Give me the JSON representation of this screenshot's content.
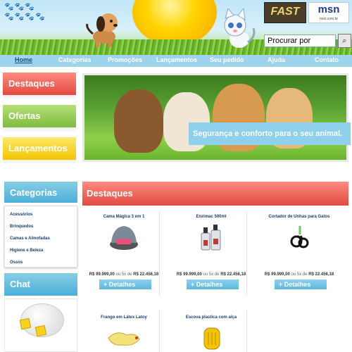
{
  "header": {
    "fast_logo": "FAST",
    "msn_logo": "msn",
    "msn_sub": "msn.com.br",
    "search_placeholder": "Procurar por",
    "search_icon": "magnifier-icon"
  },
  "nav": {
    "items": [
      "Home",
      "Categorias",
      "Promoções",
      "Lançamentos",
      "Seu pedido",
      "Ajuda",
      "Contato"
    ],
    "active": "Home"
  },
  "sidebar": {
    "tabs": [
      "Destaques",
      "Ofertas",
      "Lançamentos"
    ],
    "categories_title": "Categorias",
    "categories": [
      "Acessórios",
      "Brinquedos",
      "Camas e Almofadas",
      "Higiene e Beleza",
      "Ossos"
    ],
    "chat_title": "Chat"
  },
  "banner": {
    "tagline": "Segurança e conforto para o seu animal."
  },
  "products": {
    "title": "Destaques",
    "button_label": "+ Detalhes",
    "items": [
      {
        "name": "Cama Mágica 3 em 1",
        "price": "R$ 99.999,00",
        "ou": "ou 5x de",
        "parcel": "R$ 22.456,18"
      },
      {
        "name": "Enzimac 500ml",
        "price": "R$ 99.999,00",
        "ou": "ou 5x de",
        "parcel": "R$ 22.456,18"
      },
      {
        "name": "Cortador de Unhas para Gatos",
        "price": "R$ 99.999,00",
        "ou": "ou 5x de",
        "parcel": "R$ 22.456,18"
      },
      {
        "name": "Frango em Látex Latoy"
      },
      {
        "name": "Escova plastica com alça"
      }
    ]
  },
  "colors": {
    "red_tab": "#e24a40",
    "green_tab": "#7dbb3c",
    "yellow_tab": "#f2c400",
    "blue_tab": "#4cb0d8",
    "nav": "#9ed3ec"
  }
}
